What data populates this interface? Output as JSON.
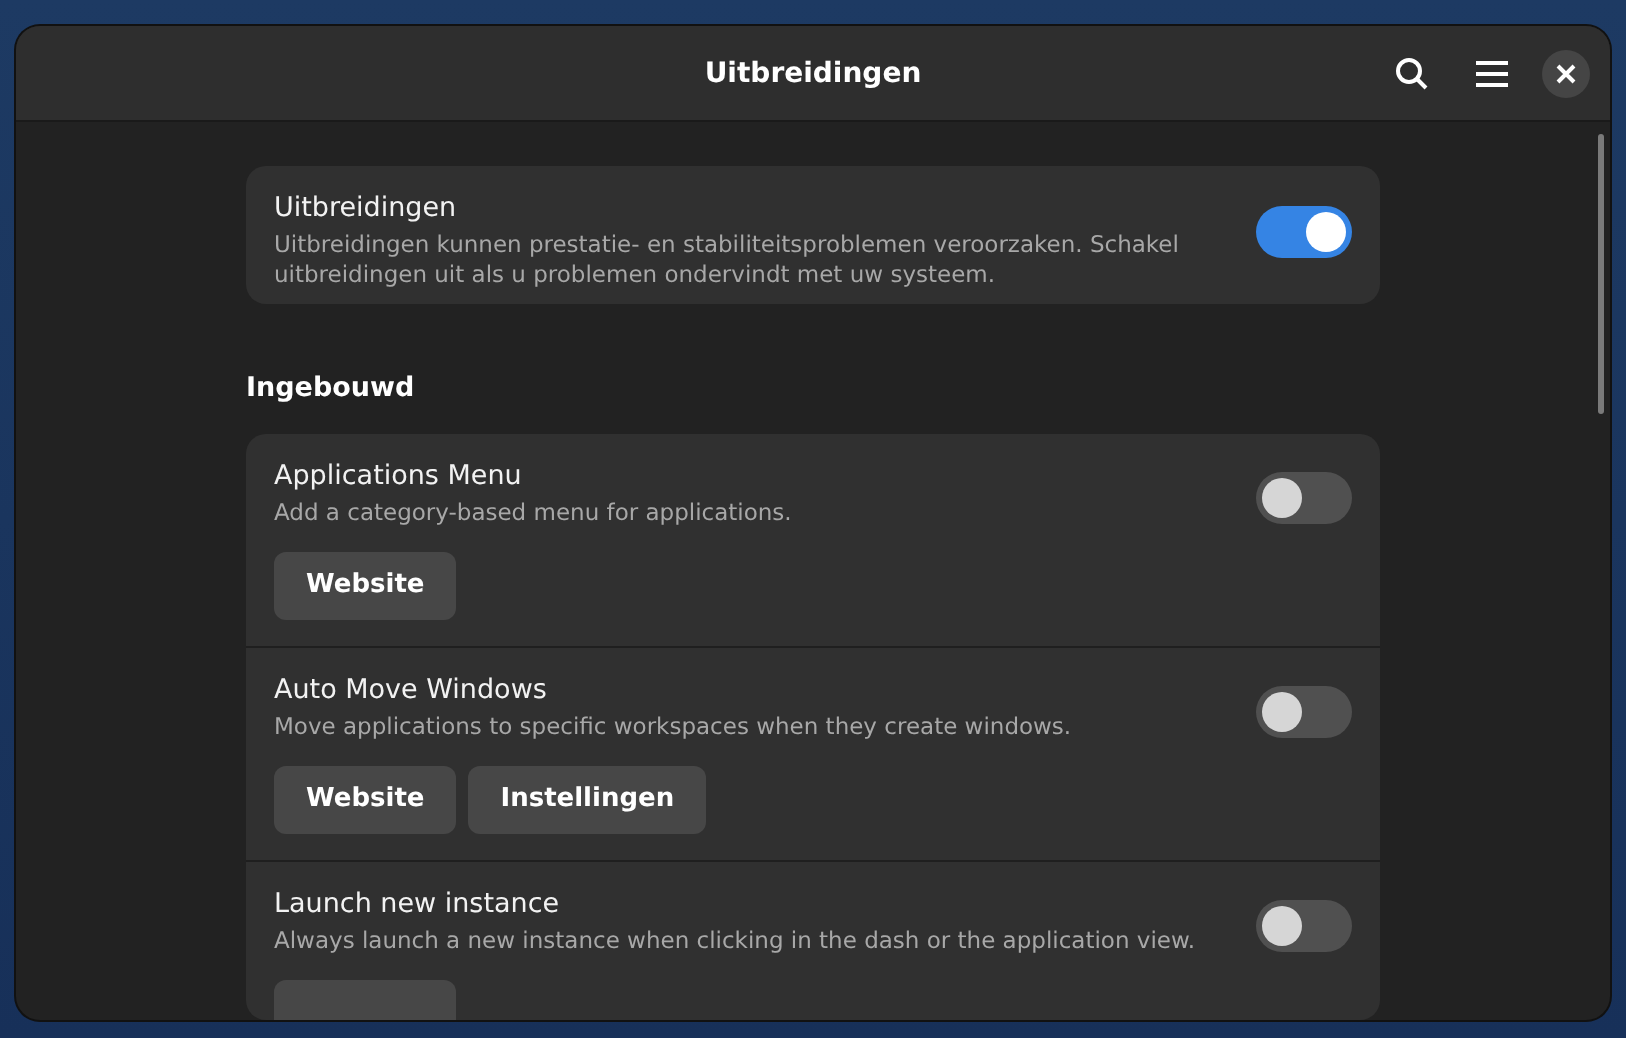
{
  "window": {
    "title": "Uitbreidingen"
  },
  "master": {
    "title": "Uitbreidingen",
    "description": "Uitbreidingen kunnen prestatie- en stabiliteitsproblemen veroorzaken. Schakel uitbreidingen uit als u problemen ondervindt met uw systeem.",
    "on": true
  },
  "section": {
    "heading": "Ingebouwd"
  },
  "extensions": [
    {
      "name": "Applications Menu",
      "description": "Add a category-based menu for applications.",
      "on": false,
      "buttons": [
        "Website"
      ]
    },
    {
      "name": "Auto Move Windows",
      "description": "Move applications to specific workspaces when they create windows.",
      "on": false,
      "buttons": [
        "Website",
        "Instellingen"
      ]
    },
    {
      "name": "Launch new instance",
      "description": "Always launch a new instance when clicking in the dash or the application view.",
      "on": false,
      "partial_button": true
    }
  ]
}
